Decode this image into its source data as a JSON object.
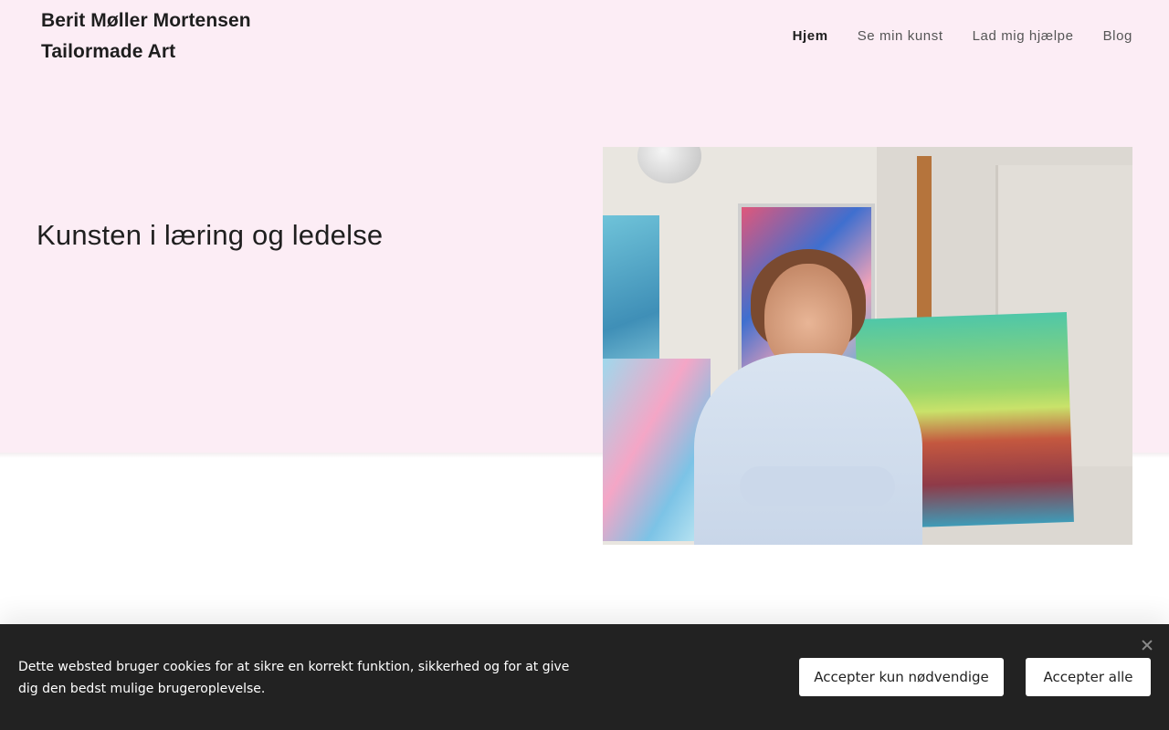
{
  "site": {
    "title_line1": "Berit Møller Mortensen",
    "title_line2": "Tailormade Art"
  },
  "nav": {
    "items": [
      {
        "label": "Hjem",
        "active": true
      },
      {
        "label": "Se min kunst",
        "active": false
      },
      {
        "label": "Lad mig hjælpe",
        "active": false
      },
      {
        "label": "Blog",
        "active": false
      }
    ]
  },
  "hero": {
    "headline": "Kunsten i læring og ledelse",
    "image": "portrait-photo"
  },
  "cookie_banner": {
    "text": "Dette websted bruger cookies for at sikre en korrekt funktion, sikkerhed og for at give dig den bedst mulige brugeroplevelse.",
    "accept_necessary_label": "Accepter kun nødvendige",
    "accept_all_label": "Accepter alle",
    "close_icon": "close-icon"
  },
  "colors": {
    "hero_bg": "#fcedf5",
    "cookie_bg": "#222222"
  }
}
